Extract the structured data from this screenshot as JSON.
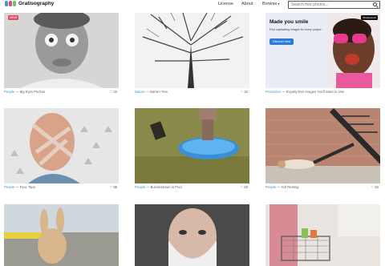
{
  "header": {
    "brand": "Gratisography",
    "brand_colors": [
      "#3a9bd5",
      "#e14b6a",
      "#6bc06a"
    ],
    "nav": {
      "license": "License",
      "about": "About",
      "browse": "Browse"
    },
    "search_placeholder": "Search free photos..."
  },
  "photos": [
    {
      "category": "People",
      "title": "Big Eyes Portrait",
      "likes": "23",
      "badge": "NEW"
    },
    {
      "category": "Nature",
      "title": "Barren Tree",
      "likes": "34"
    },
    {
      "category": "Promotion",
      "title": "Royalty-free Images You'll Want to Use",
      "promo": {
        "heading": "Made you smile",
        "body": "Find captivating images for every project",
        "button": "Discover Now",
        "logo": "Shutterstock"
      }
    },
    {
      "category": "People",
      "title": "Face Tape",
      "likes": "59"
    },
    {
      "category": "People",
      "title": "Businessman in Pool",
      "likes": "63"
    },
    {
      "category": "People",
      "title": "Girl Resting",
      "likes": "62"
    },
    {
      "category": "",
      "title": "",
      "likes": ""
    },
    {
      "category": "",
      "title": "",
      "likes": ""
    },
    {
      "category": "",
      "title": "",
      "likes": ""
    }
  ]
}
